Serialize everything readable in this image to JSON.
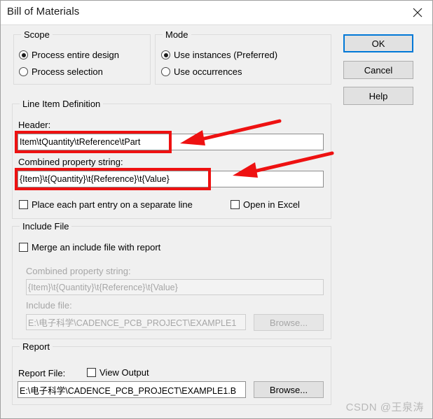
{
  "window": {
    "title": "Bill of Materials",
    "close_icon": "close-icon"
  },
  "scope": {
    "legend": "Scope",
    "options": [
      {
        "label": "Process entire design",
        "checked": true
      },
      {
        "label": "Process selection",
        "checked": false
      }
    ]
  },
  "mode": {
    "legend": "Mode",
    "options": [
      {
        "label": "Use instances (Preferred)",
        "checked": true
      },
      {
        "label": "Use occurrences",
        "checked": false
      }
    ]
  },
  "line_item_definition": {
    "legend": "Line Item Definition",
    "header_label": "Header:",
    "header_value": "Item\\tQuantity\\tReference\\tPart",
    "combined_label": "Combined property string:",
    "combined_value": "{Item}\\t{Quantity}\\t{Reference}\\t{Value}",
    "checkbox_separate_line": "Place each part entry on a separate line",
    "checkbox_separate_line_checked": false,
    "checkbox_open_excel": "Open in Excel",
    "checkbox_open_excel_checked": false
  },
  "include_file": {
    "legend": "Include File",
    "merge_checkbox": "Merge an include file with report",
    "merge_checkbox_checked": false,
    "combined_label": "Combined property string:",
    "combined_value": "{Item}\\t{Quantity}\\t{Reference}\\t{Value}",
    "include_label": "Include file:",
    "include_value": "E:\\电子科学\\CADENCE_PCB_PROJECT\\EXAMPLE1",
    "browse_label": "Browse..."
  },
  "report": {
    "legend": "Report",
    "file_label": "Report File:",
    "view_output_label": "View Output",
    "view_output_checked": false,
    "file_value": "E:\\电子科学\\CADENCE_PCB_PROJECT\\EXAMPLE1.B",
    "browse_label": "Browse..."
  },
  "buttons": {
    "ok": "OK",
    "cancel": "Cancel",
    "help": "Help"
  },
  "annotations": {
    "accent_color": "#ee1111",
    "arrow_count": 2,
    "highlight_count": 2
  },
  "watermark": {
    "text": "CSDN @王泉涛"
  }
}
